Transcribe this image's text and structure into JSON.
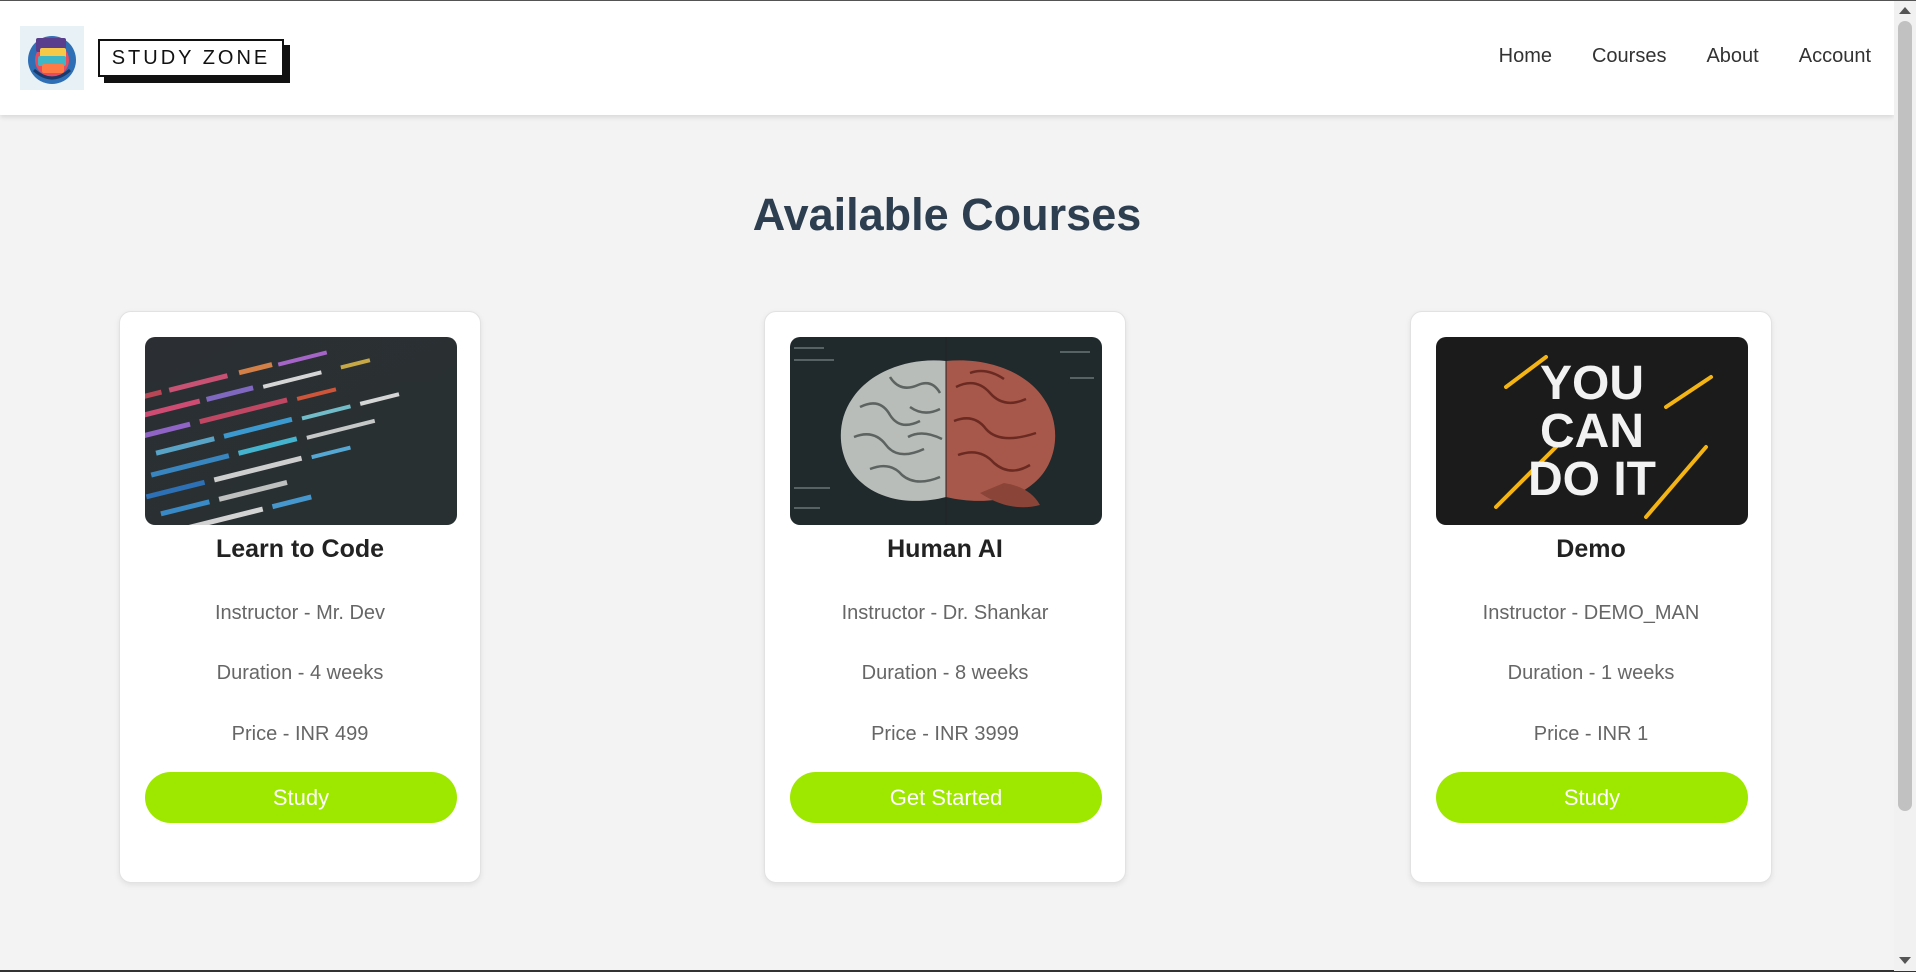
{
  "header": {
    "brand": "STUDY ZONE",
    "nav": [
      "Home",
      "Courses",
      "About",
      "Account"
    ]
  },
  "main": {
    "heading": "Available Courses",
    "courses": [
      {
        "title": "Learn to Code",
        "instructor": "Instructor - Mr. Dev",
        "duration": "Duration - 4 weeks",
        "price": "Price - INR 499",
        "button": "Study",
        "image": "code-screen-image"
      },
      {
        "title": "Human AI",
        "instructor": "Instructor - Dr. Shankar",
        "duration": "Duration - 8 weeks",
        "price": "Price - INR 3999",
        "button": "Get Started",
        "image": "brain-image"
      },
      {
        "title": "Demo",
        "instructor": "Instructor - DEMO_MAN",
        "duration": "Duration - 1 weeks",
        "price": "Price - INR 1",
        "button": "Study",
        "image": "you-can-do-it-image",
        "image_text": [
          "YOU",
          "CAN",
          "DO IT"
        ]
      }
    ]
  },
  "colors": {
    "accent": "#9ee800",
    "heading": "#2c3e50",
    "background": "#f3f3f3"
  }
}
